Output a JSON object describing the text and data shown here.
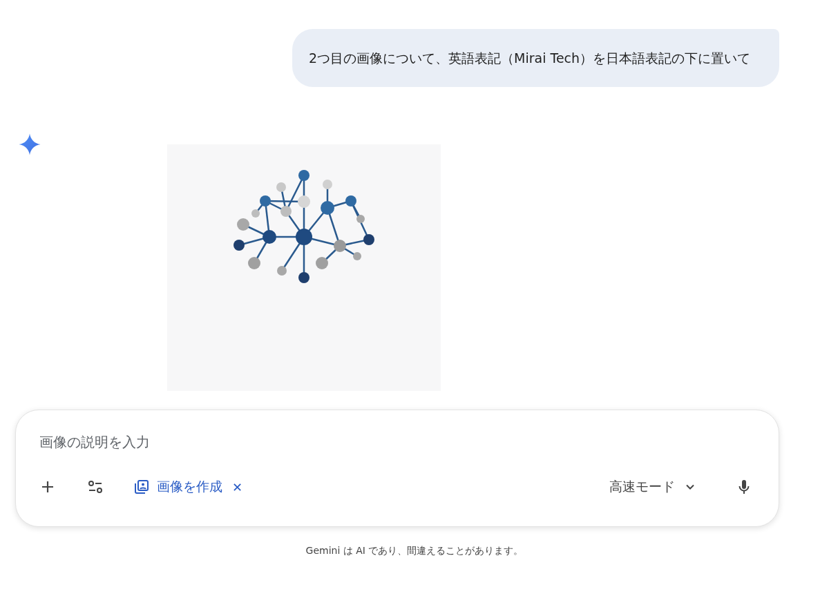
{
  "user_message": {
    "text": "2つ目の画像について、英語表記（Mirai Tech）を日本語表記の下に置いて"
  },
  "composer": {
    "placeholder": "画像の説明を入力",
    "tool_chip": {
      "label": "画像を作成",
      "close": "✕"
    },
    "mode": "高速モード"
  },
  "disclaimer": "Gemini は AI であり、間違えることがあります。"
}
